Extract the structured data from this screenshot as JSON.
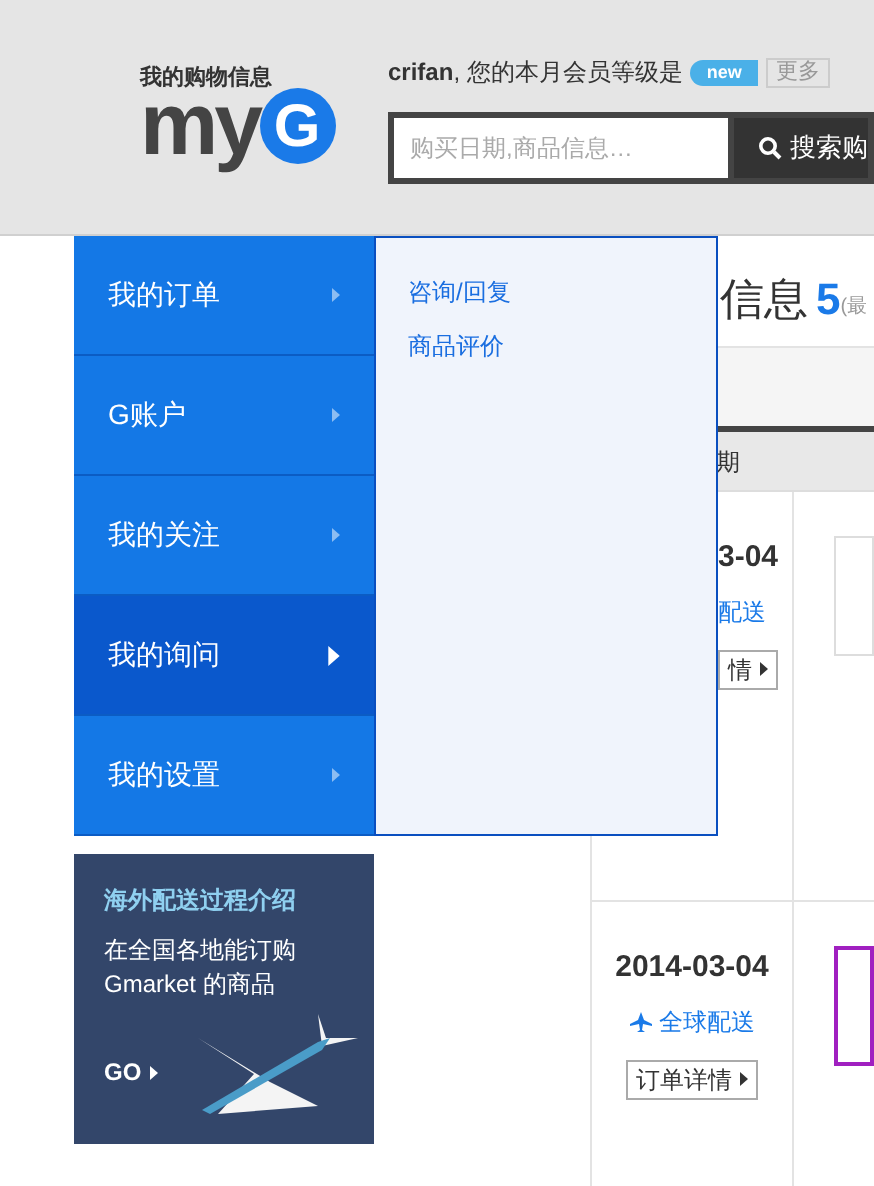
{
  "logo": {
    "caption": "我的购物信息",
    "wordmark": "my",
    "badge": "G"
  },
  "member": {
    "user": "crifan",
    "text": ", 您的本月会员等级是",
    "level_badge": "new",
    "more": "更多"
  },
  "search": {
    "placeholder": "购买日期,商品信息…",
    "button": "搜索购"
  },
  "menu": [
    {
      "label": "我的订单",
      "selected": false
    },
    {
      "label": "G账户",
      "selected": false
    },
    {
      "label": "我的关注",
      "selected": false
    },
    {
      "label": "我的询问",
      "selected": true
    },
    {
      "label": "我的设置",
      "selected": false
    }
  ],
  "submenu": [
    "咨询/回复",
    "商品评价"
  ],
  "promo": {
    "title": "海外配送过程介绍",
    "text": "在全国各地能订购 Gmarket 的商品",
    "go": "GO"
  },
  "content": {
    "heading": "信息",
    "count": "5",
    "note": "(最",
    "column": "期",
    "rows": [
      {
        "date": "3-04",
        "shipping": "配送",
        "details": "情"
      },
      {
        "date": "2014-03-04",
        "shipping": "全球配送",
        "details": "订单详情"
      }
    ]
  }
}
